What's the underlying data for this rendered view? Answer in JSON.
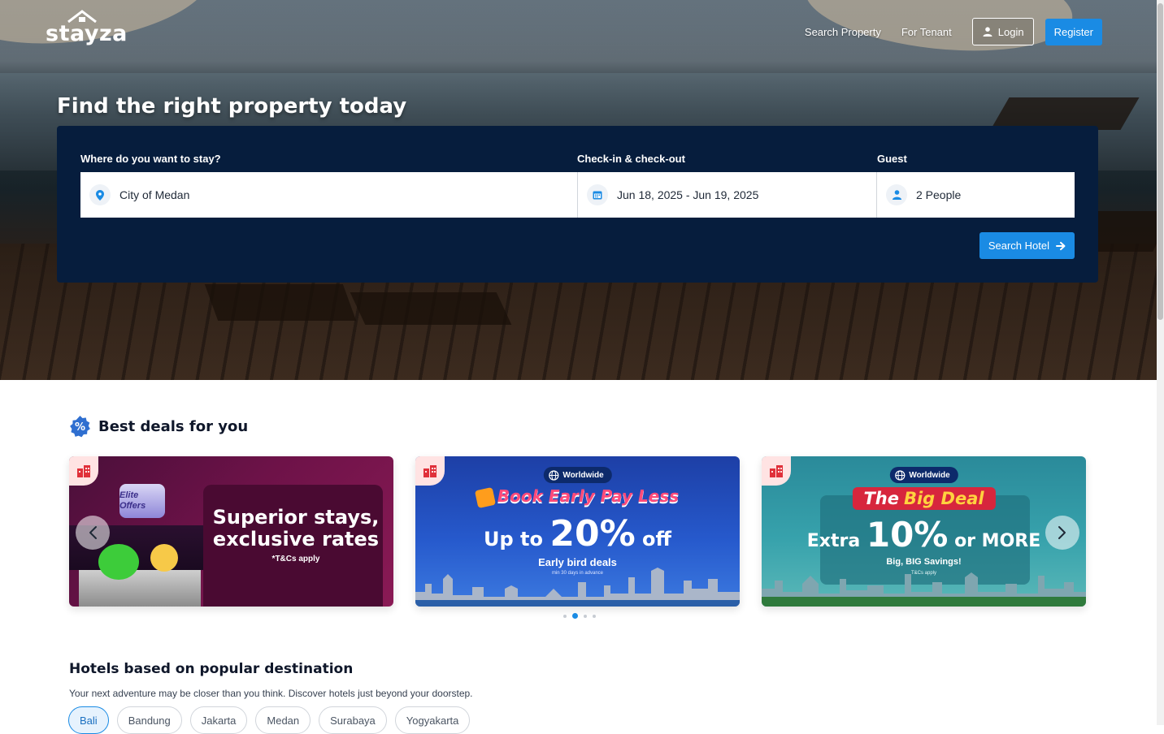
{
  "brand": {
    "name": "stayza"
  },
  "nav": {
    "search_property": "Search Property",
    "for_tenant": "For Tenant",
    "login": "Login",
    "register": "Register"
  },
  "hero": {
    "title": "Find the right property today"
  },
  "search": {
    "location_label": "Where do you want to stay?",
    "location_value": "City of Medan",
    "dates_label": "Check-in & check-out",
    "dates_value": "Jun 18, 2025 - Jun 19, 2025",
    "guest_label": "Guest",
    "guest_value": "2 People",
    "button": "Search Hotel"
  },
  "deals": {
    "title": "Best deals for you",
    "cards": [
      {
        "badge": "Elite Offers",
        "headline": "Superior stays, exclusive rates",
        "note": "*T&Cs apply"
      },
      {
        "pill": "Worldwide",
        "headline": "Book Early Pay Less",
        "prefix": "Up to",
        "big": "20%",
        "suffix": "off",
        "sub": "Early bird deals",
        "tiny": "min 30 days in advance"
      },
      {
        "pill": "Worldwide",
        "headline_a": "The",
        "headline_b": "Big Deal",
        "prefix": "Extra",
        "big": "10%",
        "suffix": "or MORE",
        "sub": "Big, BIG Savings!",
        "tiny": "T&Cs apply"
      }
    ],
    "carousel": {
      "pages": 4,
      "active": 2
    }
  },
  "popular": {
    "title": "Hotels based on popular destination",
    "subtitle": "Your next adventure may be closer than you think. Discover hotels just beyond your doorstep.",
    "cities": [
      "Bali",
      "Bandung",
      "Jakarta",
      "Medan",
      "Surabaya",
      "Yogyakarta"
    ],
    "active": "Bali"
  },
  "colors": {
    "primary": "#1a8be4",
    "panel": "#061d3d"
  },
  "icons": {
    "location": "map-pin-icon",
    "calendar": "calendar-icon",
    "guest": "user-icon",
    "login": "user-icon",
    "search_arrow": "arrow-right-icon",
    "deals": "discount-badge-icon",
    "hotel": "hotel-icon"
  }
}
